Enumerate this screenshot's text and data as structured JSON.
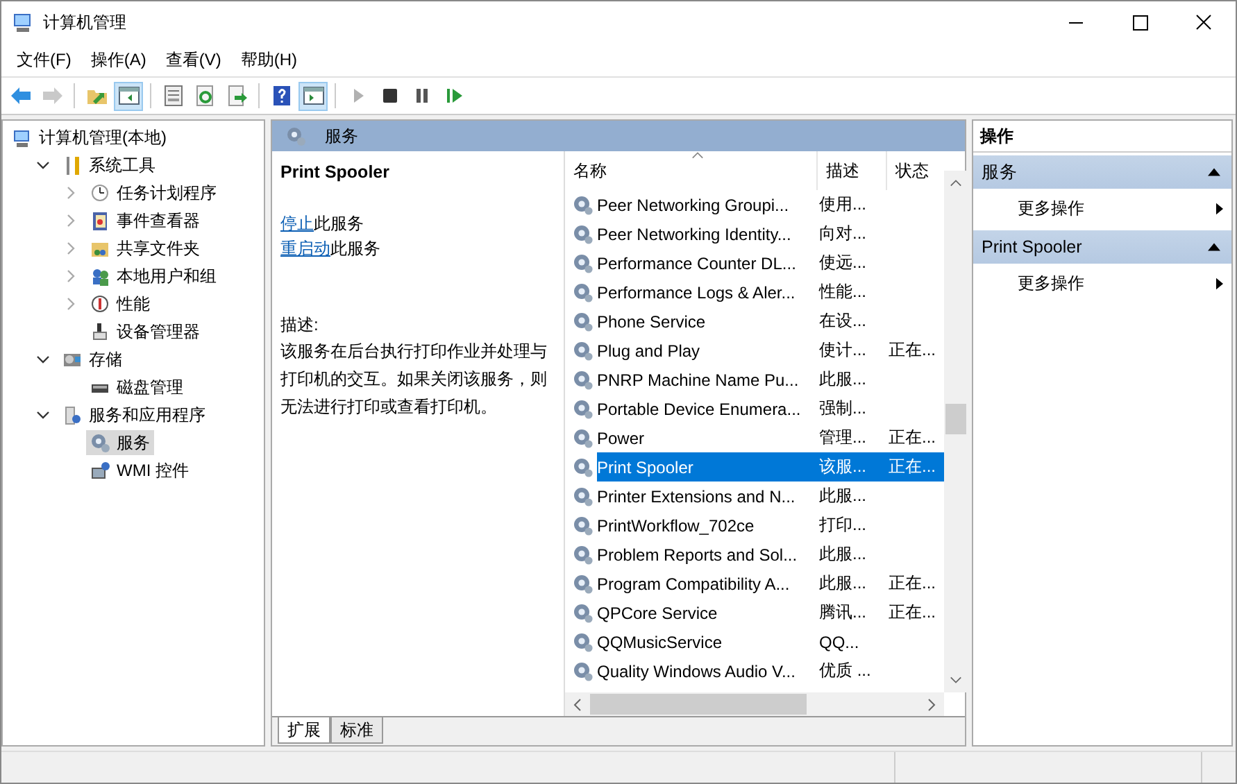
{
  "window": {
    "title": "计算机管理"
  },
  "menu": [
    "文件(F)",
    "操作(A)",
    "查看(V)",
    "帮助(H)"
  ],
  "toolbar": [
    {
      "kind": "back",
      "on": false,
      "disabled": false
    },
    {
      "kind": "forward",
      "on": false,
      "disabled": true
    },
    {
      "kind": "sep"
    },
    {
      "kind": "up",
      "on": false,
      "disabled": false
    },
    {
      "kind": "pane",
      "on": true,
      "disabled": false
    },
    {
      "kind": "sep"
    },
    {
      "kind": "properties",
      "on": false,
      "disabled": false
    },
    {
      "kind": "refresh",
      "on": false,
      "disabled": false
    },
    {
      "kind": "export",
      "on": false,
      "disabled": false
    },
    {
      "kind": "sep"
    },
    {
      "kind": "help",
      "on": false,
      "disabled": false
    },
    {
      "kind": "pane2",
      "on": true,
      "disabled": false
    },
    {
      "kind": "sep"
    },
    {
      "kind": "play",
      "on": false,
      "disabled": true
    },
    {
      "kind": "stop",
      "on": false,
      "disabled": false
    },
    {
      "kind": "pause",
      "on": false,
      "disabled": false
    },
    {
      "kind": "resume",
      "on": false,
      "disabled": false
    }
  ],
  "tree": [
    {
      "label": "计算机管理(本地)",
      "kind": "computer",
      "selected": false,
      "children": [
        {
          "label": "系统工具",
          "kind": "tools",
          "expanded": true,
          "selected": false,
          "children": [
            {
              "label": "任务计划程序",
              "kind": "clock",
              "expanded": false,
              "selected": false
            },
            {
              "label": "事件查看器",
              "kind": "event",
              "expanded": false,
              "selected": false
            },
            {
              "label": "共享文件夹",
              "kind": "folder",
              "expanded": false,
              "selected": false
            },
            {
              "label": "本地用户和组",
              "kind": "users",
              "expanded": false,
              "selected": false
            },
            {
              "label": "性能",
              "kind": "perf",
              "expanded": false,
              "selected": false
            },
            {
              "label": "设备管理器",
              "kind": "device",
              "selected": false
            }
          ]
        },
        {
          "label": "存储",
          "kind": "storage",
          "expanded": true,
          "selected": false,
          "children": [
            {
              "label": "磁盘管理",
              "kind": "disk",
              "selected": false
            }
          ]
        },
        {
          "label": "服务和应用程序",
          "kind": "server",
          "expanded": true,
          "selected": false,
          "children": [
            {
              "label": "服务",
              "kind": "services",
              "selected": true
            },
            {
              "label": "WMI 控件",
              "kind": "wmi",
              "selected": false
            }
          ]
        }
      ]
    }
  ],
  "panel": {
    "title": "服务"
  },
  "detail": {
    "title": "Print Spooler",
    "actions": [
      {
        "link": "停止",
        "text": "此服务"
      },
      {
        "link": "重启动",
        "text": "此服务"
      }
    ],
    "description_label": "描述:",
    "description": "该服务在后台执行打印作业并处理与打印机的交互。如果关闭该服务，则无法进行打印或查看打印机。"
  },
  "table": {
    "columns": [
      {
        "label": "名称",
        "sorted": true
      },
      {
        "label": "描述",
        "sorted": false
      },
      {
        "label": "状态",
        "sorted": false
      }
    ],
    "rows": [
      {
        "name": "Peer Networking Groupi...",
        "desc": "使用...",
        "status": "",
        "selected": false
      },
      {
        "name": "Peer Networking Identity...",
        "desc": "向对...",
        "status": "",
        "selected": false
      },
      {
        "name": "Performance Counter DL...",
        "desc": "使远...",
        "status": "",
        "selected": false
      },
      {
        "name": "Performance Logs & Aler...",
        "desc": "性能...",
        "status": "",
        "selected": false
      },
      {
        "name": "Phone Service",
        "desc": "在设...",
        "status": "",
        "selected": false
      },
      {
        "name": "Plug and Play",
        "desc": "使计...",
        "status": "正在...",
        "selected": false
      },
      {
        "name": "PNRP Machine Name Pu...",
        "desc": "此服...",
        "status": "",
        "selected": false
      },
      {
        "name": "Portable Device Enumera...",
        "desc": "强制...",
        "status": "",
        "selected": false
      },
      {
        "name": "Power",
        "desc": "管理...",
        "status": "正在...",
        "selected": false
      },
      {
        "name": "Print Spooler",
        "desc": "该服...",
        "status": "正在...",
        "selected": true
      },
      {
        "name": "Printer Extensions and N...",
        "desc": "此服...",
        "status": "",
        "selected": false
      },
      {
        "name": "PrintWorkflow_702ce",
        "desc": "打印...",
        "status": "",
        "selected": false
      },
      {
        "name": "Problem Reports and Sol...",
        "desc": "此服...",
        "status": "",
        "selected": false
      },
      {
        "name": "Program Compatibility A...",
        "desc": "此服...",
        "status": "正在...",
        "selected": false
      },
      {
        "name": "QPCore Service",
        "desc": "腾讯...",
        "status": "正在...",
        "selected": false
      },
      {
        "name": "QQMusicService",
        "desc": "QQ...",
        "status": "",
        "selected": false
      },
      {
        "name": "Quality Windows Audio V...",
        "desc": "优质 ...",
        "status": "",
        "selected": false
      }
    ]
  },
  "view_tabs": [
    {
      "label": "扩展",
      "selected": true
    },
    {
      "label": "标准",
      "selected": false
    }
  ],
  "actions": {
    "title": "操作",
    "sections": [
      {
        "title": "服务",
        "expanded": true,
        "items": [
          "更多操作"
        ]
      },
      {
        "title": "Print Spooler",
        "expanded": true,
        "items": [
          "更多操作"
        ]
      }
    ]
  }
}
